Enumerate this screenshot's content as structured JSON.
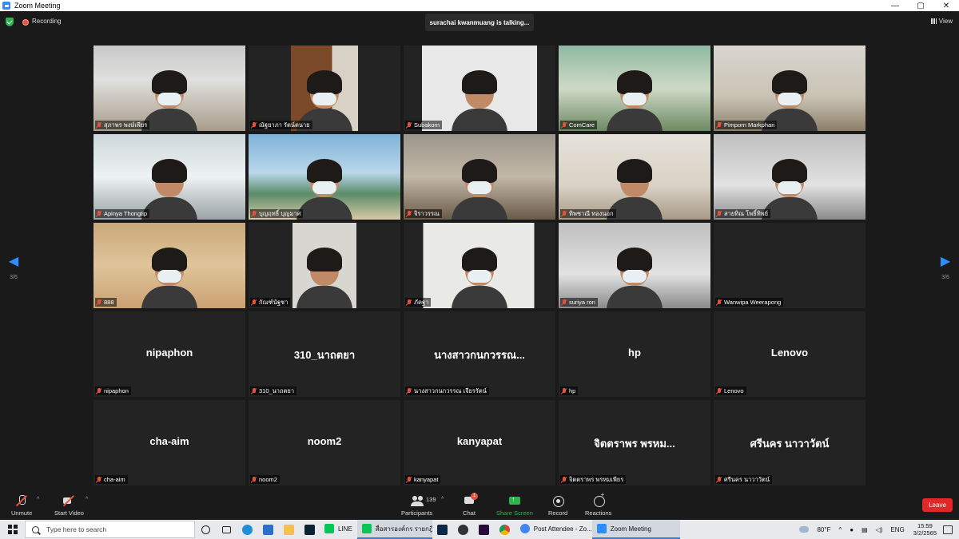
{
  "window": {
    "title": "Zoom Meeting",
    "controls": [
      "—",
      "▢",
      "✕"
    ]
  },
  "header": {
    "recording_label": "Recording",
    "talking": "surachai kwanmuang is talking...",
    "view_label": "View"
  },
  "pager": {
    "left": "3/6",
    "right": "3/6"
  },
  "tiles": [
    {
      "name": "สุภาพร พงษ์เพียร",
      "bg": "bg-office"
    },
    {
      "name": "ณัฐยาภา รัตน์ตนาย",
      "bg": "bg-wood"
    },
    {
      "name": "Subakorn",
      "bg": "bg-white"
    },
    {
      "name": "ComCare",
      "bg": "bg-green"
    },
    {
      "name": "Pimporn Markphan",
      "bg": "bg-room"
    },
    {
      "name": "Apinya Thongtip",
      "bg": "bg-cyan"
    },
    {
      "name": "บุญฤทธิ์ บุญมาศ",
      "bg": "bg-beach"
    },
    {
      "name": "จิราวรรณ",
      "bg": "bg-desk"
    },
    {
      "name": "ทิพชาณี ทองนอก",
      "bg": "bg-light"
    },
    {
      "name": "สายทิณ โพธิ์ทิพย์",
      "bg": "bg-gray"
    },
    {
      "name": "888",
      "bg": "bg-warm"
    },
    {
      "name": "กัณฑ์นัฐชา",
      "bg": "bg-ceiling"
    },
    {
      "name": "ภัคฐา",
      "bg": "bg-wall"
    },
    {
      "name": "suriya ron",
      "bg": "bg-gray"
    },
    {
      "name": "Wanwipa Weerapong",
      "bg": ""
    },
    {
      "name": "nipaphon",
      "big": "nipaphon"
    },
    {
      "name": "310_นาถตยา",
      "big": "310_นาถตยา"
    },
    {
      "name": "นางสาวกนกวรรณ เจียรรัตน์",
      "big": "นางสาวกนกวรรณ..."
    },
    {
      "name": "hp",
      "big": "hp"
    },
    {
      "name": "Lenovo",
      "big": "Lenovo"
    },
    {
      "name": "cha-aim",
      "big": "cha-aim"
    },
    {
      "name": "noom2",
      "big": "noom2"
    },
    {
      "name": "kanyapat",
      "big": "kanyapat"
    },
    {
      "name": "จิตตราพร พรหมเพียร",
      "big": "จิตตราพร พรหม..."
    },
    {
      "name": "ศรีนคร นาวาวัตน์",
      "big": "ศรีนคร นาวาวัตน์"
    }
  ],
  "toolbar": {
    "unmute": "Unmute",
    "start_video": "Start Video",
    "participants": "Participants",
    "participants_count": "139",
    "chat": "Chat",
    "chat_badge": "1",
    "share_screen": "Share Screen",
    "record": "Record",
    "reactions": "Reactions",
    "leave": "Leave"
  },
  "taskbar": {
    "search_placeholder": "Type here to search",
    "apps": [
      {
        "label": "LINE",
        "color": "#06c755"
      },
      {
        "label": "สื่อสารองค์กร รายกฎิน...",
        "color": "#06c755",
        "active": true
      },
      {
        "label": "Post Attendee - Zo...",
        "color": "#4285f4"
      },
      {
        "label": "Zoom Meeting",
        "color": "#2D8CFF",
        "active": true
      }
    ],
    "temperature": "80°F",
    "language": "ENG",
    "time": "15:59",
    "date": "3/2/2565"
  }
}
